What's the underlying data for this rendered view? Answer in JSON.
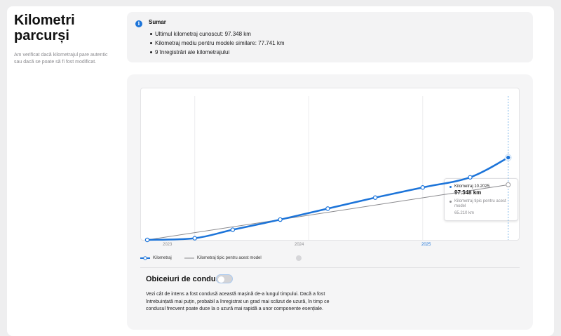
{
  "page": {
    "title": "Kilometri parcurși",
    "description": "Am verificat dacă kilometrajul pare autentic sau dacă se poate să fi fost modificat."
  },
  "summary": {
    "title": "Sumar",
    "icon": "info-icon",
    "items": [
      "Ultimul kilometraj cunoscut: 97.348 km",
      "Kilometraj mediu pentru modele similare: 77.741 km",
      "9 înregistrări ale kilometrajului"
    ]
  },
  "chart_data": {
    "type": "line",
    "x_ticks": [
      "2023",
      "2024",
      "2025"
    ],
    "highlighted_tick": "2025",
    "series": [
      {
        "name": "Kilometraj",
        "color": "#1c74d9",
        "points": [
          {
            "x": "2022-08",
            "y": 0
          },
          {
            "x": "2023-01",
            "y": 2000
          },
          {
            "x": "2023-05",
            "y": 12000
          },
          {
            "x": "2023-10",
            "y": 24000
          },
          {
            "x": "2024-03",
            "y": 37000
          },
          {
            "x": "2024-08",
            "y": 50000
          },
          {
            "x": "2025-01",
            "y": 62000
          },
          {
            "x": "2025-06",
            "y": 74000
          },
          {
            "x": "2025-10",
            "y": 97348
          }
        ]
      },
      {
        "name": "Kilometraj tipic pentru acest model",
        "color": "#8a8a8e",
        "points": [
          {
            "x": "2022-08",
            "y": 0
          },
          {
            "x": "2025-10",
            "y": 65210
          }
        ]
      }
    ],
    "ylim": [
      0,
      170000
    ],
    "grid": true
  },
  "tooltip": {
    "label": "Kilometraj 10.2025",
    "value": "97.348 km",
    "typical_label": "Kilometraj tipic pentru acest model",
    "typical_value": "65.210 km"
  },
  "legend": {
    "mileage": "Kilometraj",
    "typical": "Kilometraj tipic pentru acest model",
    "help_icon": "help-icon"
  },
  "driving": {
    "title": "Obiceiuri de condus",
    "toggle_on": false,
    "description": "Vezi cât de intens a fost condusă această mașină de-a lungul timpului. Dacă a fost întrebuințată mai puțin, probabil a înregistrat un grad mai scăzut de uzură, în timp ce condusul frecvent poate duce la o uzură mai rapidă a unor componente esențiale."
  },
  "colors": {
    "accent": "#1c74d9",
    "typical_line": "#8a8a8e"
  }
}
